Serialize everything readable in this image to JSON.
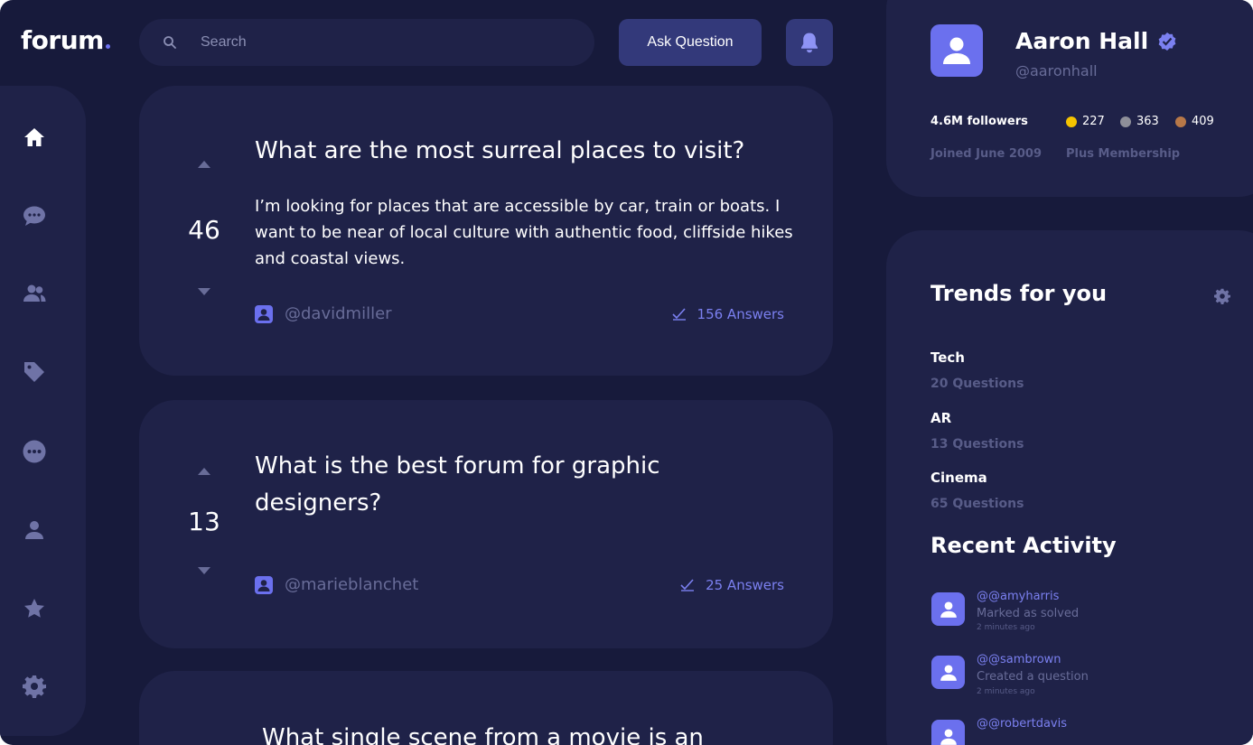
{
  "app": {
    "logo": "forum"
  },
  "search": {
    "placeholder": "Search"
  },
  "header": {
    "ask_label": "Ask Question"
  },
  "sidebar": {
    "items": [
      {
        "icon": "home-icon"
      },
      {
        "icon": "chat-icon"
      },
      {
        "icon": "users-icon"
      },
      {
        "icon": "tag-icon"
      },
      {
        "icon": "more-icon"
      },
      {
        "icon": "user-icon"
      },
      {
        "icon": "star-icon"
      },
      {
        "icon": "gear-icon"
      }
    ]
  },
  "questions": [
    {
      "votes": "46",
      "title": "What are the most surreal places to visit?",
      "body": "I’m looking for places that are accessible by car, train or boats. I want to be near of local culture with authentic food, cliffside hikes and coastal views.",
      "author": "@davidmiller",
      "answers": "156 Answers"
    },
    {
      "votes": "13",
      "title": "What is the best forum for graphic designers?",
      "body": "",
      "author": "@marieblanchet",
      "answers": "25 Answers"
    },
    {
      "votes": "",
      "title": "What single scene from a movie is an",
      "body": "",
      "author": "",
      "answers": ""
    }
  ],
  "profile": {
    "name": "Aaron Hall",
    "handle": "@aaronhall",
    "followers": "4.6M followers",
    "badges": [
      {
        "count": "227",
        "color": "#f5c400"
      },
      {
        "count": "363",
        "color": "#8e8f99"
      },
      {
        "count": "409",
        "color": "#b87848"
      }
    ],
    "joined": "Joined June 2009",
    "membership": "Plus Membership"
  },
  "trends": {
    "title": "Trends for you",
    "items": [
      {
        "name": "Tech",
        "count": "20 Questions"
      },
      {
        "name": "AR",
        "count": "13 Questions"
      },
      {
        "name": "Cinema",
        "count": "65 Questions"
      }
    ]
  },
  "activity": {
    "title": "Recent Activity",
    "items": [
      {
        "user": "@@amyharris",
        "action": "Marked as solved",
        "time": "2 minutes ago"
      },
      {
        "user": "@@sambrown",
        "action": "Created a question",
        "time": "2 minutes ago"
      },
      {
        "user": "@@robertdavis",
        "action": "",
        "time": ""
      }
    ]
  },
  "colors": {
    "background": "#171a3b",
    "card": "#1f2248",
    "accent": "#6b70ee",
    "button": "#33397a"
  }
}
